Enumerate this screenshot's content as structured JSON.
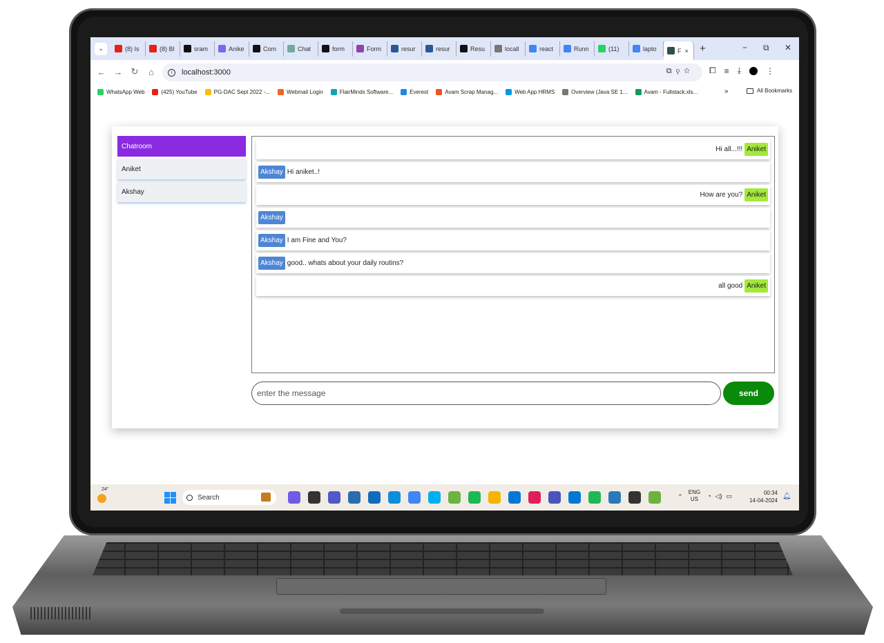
{
  "browser": {
    "tabs": [
      {
        "label": "(8) Is",
        "icon": "youtube-icon",
        "color": "#e62117"
      },
      {
        "label": "(8) Bl",
        "icon": "youtube-icon",
        "color": "#e62117"
      },
      {
        "label": "sram",
        "icon": "github-icon",
        "color": "#111111"
      },
      {
        "label": "Anike",
        "icon": "github-user-icon",
        "color": "#7b68ee"
      },
      {
        "label": "Com",
        "icon": "github-icon",
        "color": "#111111"
      },
      {
        "label": "Chat",
        "icon": "chatgpt-icon",
        "color": "#74aa9c"
      },
      {
        "label": "form",
        "icon": "circle-icon",
        "color": "#111111"
      },
      {
        "label": "Form",
        "icon": "formik-icon",
        "color": "#8e44ad"
      },
      {
        "label": "resur",
        "icon": "word-icon",
        "color": "#2b579a"
      },
      {
        "label": "resur",
        "icon": "word-icon",
        "color": "#2b579a"
      },
      {
        "label": "Resu",
        "icon": "github-icon",
        "color": "#111111"
      },
      {
        "label": "locall",
        "icon": "globe-icon",
        "color": "#777777"
      },
      {
        "label": "react",
        "icon": "google-icon",
        "color": "#4285f4"
      },
      {
        "label": "Runn",
        "icon": "google-icon",
        "color": "#4285f4"
      },
      {
        "label": "(11)",
        "icon": "whatsapp-icon",
        "color": "#25d366"
      },
      {
        "label": "lapto",
        "icon": "google-icon",
        "color": "#4285f4"
      }
    ],
    "active_tab": {
      "label": "F",
      "close": "×"
    },
    "new_tab": "+",
    "window_controls": {
      "minimize": "−",
      "restore": "⧉",
      "close": "✕"
    },
    "url": "localhost:3000",
    "bookmarks": [
      {
        "label": "WhatsApp Web",
        "color": "#25d366"
      },
      {
        "label": "(425) YouTube",
        "color": "#e62117"
      },
      {
        "label": "PG-DAC Sept 2022 -...",
        "color": "#fbbc04"
      },
      {
        "label": "Webmail Login",
        "color": "#f26522"
      },
      {
        "label": "FlairMinds Software...",
        "color": "#0fa3b1"
      },
      {
        "label": "Everest",
        "color": "#1e88e5"
      },
      {
        "label": "Avam Scrap Manag...",
        "color": "#f25022"
      },
      {
        "label": "Web App HRMS",
        "color": "#0099e5"
      },
      {
        "label": "Overview (Java SE 1...",
        "color": "#777777"
      },
      {
        "label": "Avam - Fullstack.xls...",
        "color": "#0f9d58"
      }
    ],
    "bookmarks_more": "»",
    "all_bookmarks": "All Bookmarks"
  },
  "app": {
    "sidebar": [
      {
        "label": "Chatroom",
        "active": true
      },
      {
        "label": "Aniket",
        "active": false
      },
      {
        "label": "Akshay",
        "active": false
      }
    ],
    "messages": [
      {
        "sender": "Aniket",
        "text": "Hi all...!!!",
        "side": "right"
      },
      {
        "sender": "Akshay",
        "text": "Hi aniket..!",
        "side": "left"
      },
      {
        "sender": "Aniket",
        "text": "How are you?",
        "side": "right"
      },
      {
        "sender": "Akshay",
        "text": "",
        "side": "left"
      },
      {
        "sender": "Akshay",
        "text": "I am Fine and You?",
        "side": "left"
      },
      {
        "sender": "Akshay",
        "text": "good.. whats about your daily routins?",
        "side": "left"
      },
      {
        "sender": "Aniket",
        "text": "all good",
        "side": "right"
      }
    ],
    "input_placeholder": "enter the message",
    "send_label": "send",
    "colors": {
      "chatroom_active": "#8a2be2",
      "akshay_badge": "#4e86d6",
      "aniket_badge": "#a4e83a",
      "send_button": "#0a8a0a"
    }
  },
  "taskbar": {
    "temperature": "24°",
    "search_placeholder": "Search",
    "apps": [
      {
        "name": "copilot-icon",
        "color": "#6e5ce6"
      },
      {
        "name": "files-icon",
        "color": "#333333"
      },
      {
        "name": "teams-icon",
        "color": "#5059c9"
      },
      {
        "name": "store-icon",
        "color": "#2b6cb0"
      },
      {
        "name": "mail-icon",
        "color": "#0f6cbd"
      },
      {
        "name": "edge-icon",
        "color": "#0c8ed9"
      },
      {
        "name": "chrome-icon",
        "color": "#4285f4"
      },
      {
        "name": "skype-icon",
        "color": "#00aff0"
      },
      {
        "name": "spring-icon",
        "color": "#6db33f"
      },
      {
        "name": "spotify-icon",
        "color": "#1db954"
      },
      {
        "name": "explorer-icon",
        "color": "#f4b400"
      },
      {
        "name": "vscode-icon",
        "color": "#0078d4"
      },
      {
        "name": "slack-icon",
        "color": "#e01e5a"
      },
      {
        "name": "teams2-icon",
        "color": "#4b53bc"
      },
      {
        "name": "outlook-icon",
        "color": "#0078d4"
      },
      {
        "name": "spotify2-icon",
        "color": "#1db954"
      },
      {
        "name": "notepad-icon",
        "color": "#2a7ab9"
      },
      {
        "name": "terminal-icon",
        "color": "#333333"
      },
      {
        "name": "spring2-icon",
        "color": "#6db33f"
      }
    ],
    "tray_chevron": "^",
    "language": {
      "line1": "ENG",
      "line2": "US"
    },
    "time": "00:34",
    "date": "14-04-2024"
  }
}
